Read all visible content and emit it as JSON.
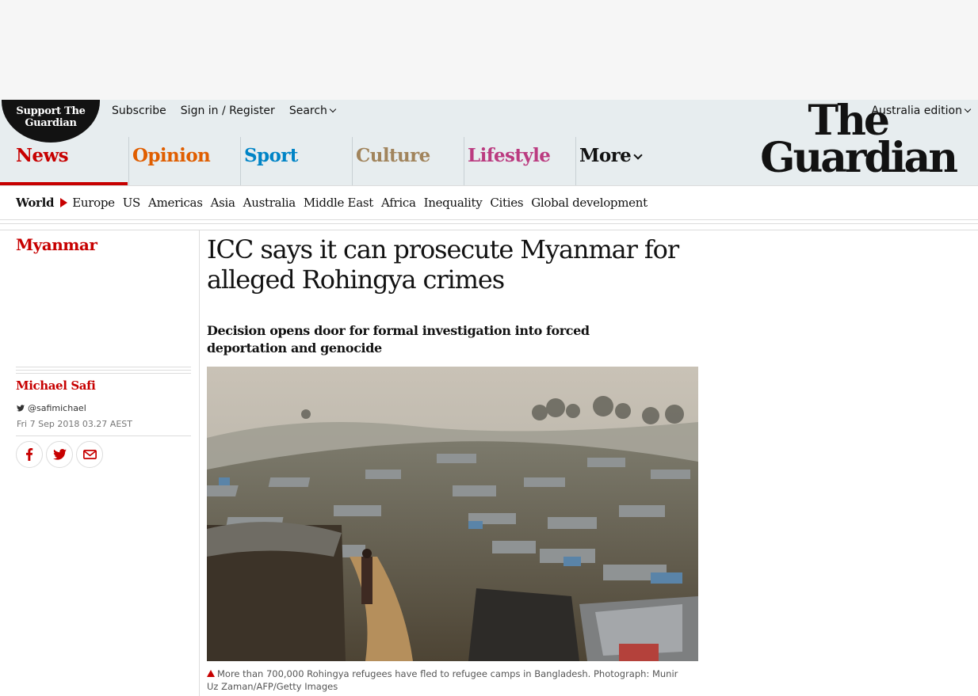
{
  "header": {
    "support_label": "Support The Guardian",
    "links": [
      "Subscribe",
      "Sign in / Register",
      "Search"
    ],
    "edition": "Australia edition",
    "logo_line1": "The",
    "logo_line2": "Guardian"
  },
  "pillars": [
    {
      "label": "News",
      "color": "#c70000"
    },
    {
      "label": "Opinion",
      "color": "#e05e00"
    },
    {
      "label": "Sport",
      "color": "#0084c6"
    },
    {
      "label": "Culture",
      "color": "#a1845c"
    },
    {
      "label": "Lifestyle",
      "color": "#bb3b80"
    },
    {
      "label": "More",
      "color": "#121212"
    }
  ],
  "subnav": {
    "current": "World",
    "items": [
      "Europe",
      "US",
      "Americas",
      "Asia",
      "Australia",
      "Middle East",
      "Africa",
      "Inequality",
      "Cities",
      "Global development"
    ]
  },
  "article": {
    "section": "Myanmar",
    "headline": "ICC says it can prosecute Myanmar for alleged Rohingya crimes",
    "standfirst": "Decision opens door for formal investigation into forced deportation and genocide",
    "byline": "Michael Safi",
    "twitter": "@safimichael",
    "date": "Fri 7 Sep 2018 03.27 AEST",
    "share_icons": [
      "facebook-icon",
      "twitter-icon",
      "email-icon"
    ],
    "caption": "More than 700,000 Rohingya refugees have fled to refugee camps in Bangladesh. Photograph: Munir Uz Zaman/AFP/Getty Images"
  },
  "colors": {
    "accent": "#c70000",
    "header_bg": "#e7edef"
  }
}
